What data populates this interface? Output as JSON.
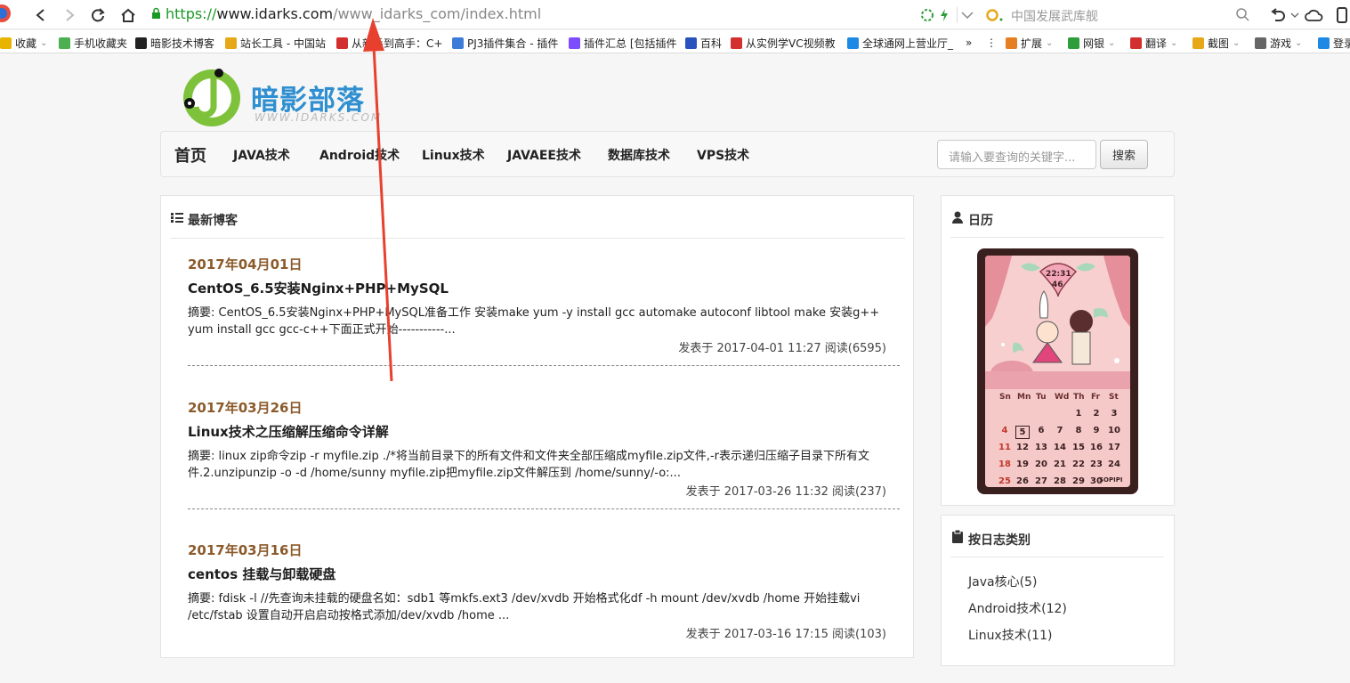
{
  "browser": {
    "url": {
      "scheme": "https://",
      "host": "www.idarks.com",
      "path": "/www_idarks_com/index.html"
    },
    "search_placeholder": "中国发展武库舰",
    "bookmarks": [
      {
        "label": "收藏",
        "color": "#e8b400",
        "dropdown": true
      },
      {
        "label": "手机收藏夹",
        "color": "#4caf50",
        "dropdown": false
      },
      {
        "label": "暗影技术博客",
        "color": "#222222",
        "dropdown": false
      },
      {
        "label": "站长工具 - 中国站",
        "color": "#e6a817",
        "dropdown": false
      },
      {
        "label": "从新手到高手：C+",
        "color": "#d32f2f",
        "dropdown": false
      },
      {
        "label": "PJ3插件集合 - 插件",
        "color": "#3d7bd9",
        "dropdown": false
      },
      {
        "label": "插件汇总 [包括插件",
        "color": "#7c4dff",
        "dropdown": false
      },
      {
        "label": "百科",
        "color": "#2a52be",
        "dropdown": false
      },
      {
        "label": "从实例学VC视频教",
        "color": "#d32f2f",
        "dropdown": false
      },
      {
        "label": "全球通网上营业厅_",
        "color": "#1e88e5",
        "dropdown": false
      }
    ],
    "extensions": [
      {
        "label": "扩展",
        "color": "#e67e22"
      },
      {
        "label": "网银",
        "color": "#2e9d3a"
      },
      {
        "label": "翻译",
        "color": "#d32f2f"
      },
      {
        "label": "截图",
        "color": "#e6a817"
      },
      {
        "label": "游戏",
        "color": "#666666"
      },
      {
        "label": "登录",
        "color": "#1e88e5"
      }
    ]
  },
  "site": {
    "logo_title": "暗影部落",
    "logo_sub": "WWW.IDARKS.COM",
    "nav": [
      "首页",
      "JAVA技术",
      "Android技术",
      "Linux技术",
      "JAVAEE技术",
      "数据库技术",
      "VPS技术"
    ],
    "search_placeholder": "请输入要查询的关键字...",
    "search_button": "搜索"
  },
  "main": {
    "title": "最新博客",
    "posts": [
      {
        "date": "2017年04月01日",
        "title": "CentOS_6.5安装Nginx+PHP+MySQL",
        "summary": "摘要: CentOS_6.5安装Nginx+PHP+MySQL准备工作 安装make yum -y install gcc automake autoconf libtool make 安装g++ yum install gcc gcc-c++下面正式开始-----------...",
        "meta": "发表于 2017-04-01 11:27 阅读(6595)"
      },
      {
        "date": "2017年03月26日",
        "title": "Linux技术之压缩解压缩命令详解",
        "summary": "摘要: linux zip命令zip -r myfile.zip ./*将当前目录下的所有文件和文件夹全部压缩成myfile.zip文件,-r表示递归压缩子目录下所有文件.2.unzipunzip -o -d /home/sunny myfile.zip把myfile.zip文件解压到 /home/sunny/-o:...",
        "meta": "发表于 2017-03-26 11:32 阅读(237)"
      },
      {
        "date": "2017年03月16日",
        "title": "centos 挂载与卸载硬盘",
        "summary": "摘要: fdisk -l //先查询未挂载的硬盘名如：sdb1 等mkfs.ext3 /dev/xvdb 开始格式化df -h mount /dev/xvdb /home 开始挂载vi /etc/fstab 设置自动开启启动按格式添加/dev/xvdb /home ...",
        "meta": "发表于 2017-03-16 17:15 阅读(103)"
      }
    ]
  },
  "sidebar": {
    "calendar_title": "日历",
    "calendar": {
      "time": "22:31",
      "seconds": "46",
      "dow": [
        "Sn",
        "Mn",
        "Tu",
        "Wd",
        "Th",
        "Fr",
        "St"
      ],
      "weeks": [
        [
          "",
          "",
          "",
          "",
          "1",
          "2",
          "3"
        ],
        [
          "4",
          "5",
          "6",
          "7",
          "8",
          "9",
          "10"
        ],
        [
          "11",
          "12",
          "13",
          "14",
          "15",
          "16",
          "17"
        ],
        [
          "18",
          "19",
          "20",
          "21",
          "22",
          "23",
          "24"
        ],
        [
          "25",
          "26",
          "27",
          "28",
          "29",
          "30",
          ""
        ]
      ],
      "today": "5",
      "brand": "SOPIPI"
    },
    "categories_title": "按日志类别",
    "categories": [
      "Java核心(5)",
      "Android技术(12)",
      "Linux技术(11)"
    ]
  }
}
